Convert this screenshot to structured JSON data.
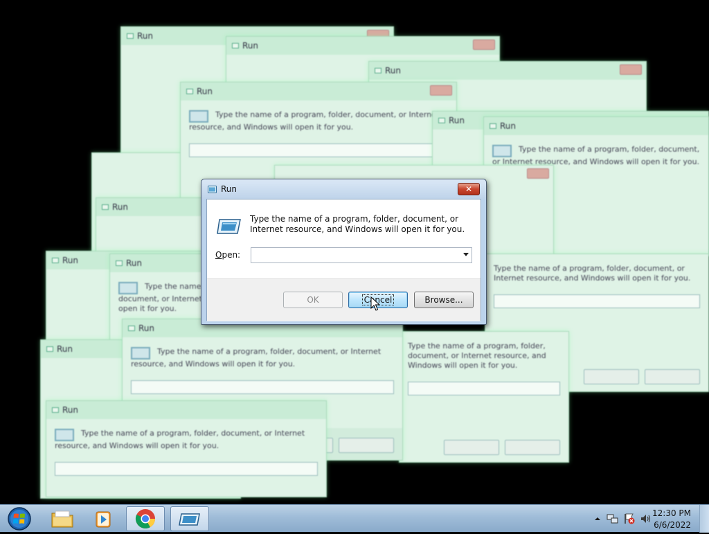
{
  "dialog": {
    "title": "Run",
    "close_label": "✕",
    "description": "Type the name of a program, folder, document, or Internet resource, and Windows will open it for you.",
    "open_label_accel": "O",
    "open_label_rest": "pen:",
    "open_value": "",
    "buttons": {
      "ok": "OK",
      "cancel": "Cancel",
      "browse": "Browse..."
    }
  },
  "taskbar": {
    "items": [
      "start-orb",
      "windows-explorer",
      "media-player",
      "google-chrome",
      "run-dialog"
    ],
    "clock_time": "12:30 PM",
    "clock_date": "6/6/2022"
  },
  "colors": {
    "desktop": "#000000",
    "ghost_tint": "#dff3e6",
    "close_red": "#c8452e",
    "focus_blue": "#bee6fd"
  }
}
